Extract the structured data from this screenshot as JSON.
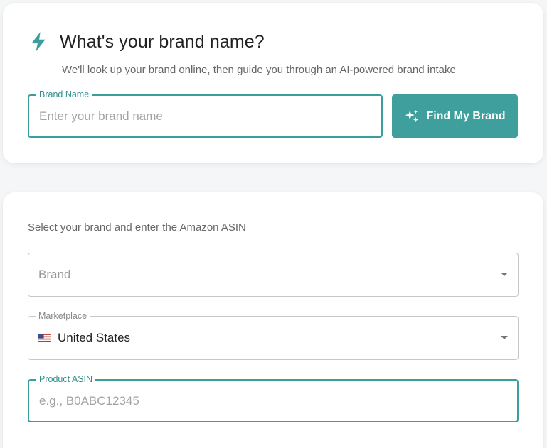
{
  "intake": {
    "title": "What's your brand name?",
    "subtitle": "We'll look up your brand online, then guide you through an AI-powered brand intake",
    "brand_name_label": "Brand Name",
    "brand_name_placeholder": "Enter your brand name",
    "find_button_label": "Find My Brand",
    "accent_color": "#3f9f9c",
    "title_icon": "bolt-icon",
    "button_icon": "sparkles-icon"
  },
  "selection": {
    "instruction": "Select your brand and enter the Amazon ASIN",
    "brand_select_placeholder": "Brand",
    "marketplace_label": "Marketplace",
    "marketplace_value": "United States",
    "marketplace_flag_icon": "us-flag-icon",
    "asin_label": "Product ASIN",
    "asin_placeholder": "e.g., B0ABC12345"
  }
}
